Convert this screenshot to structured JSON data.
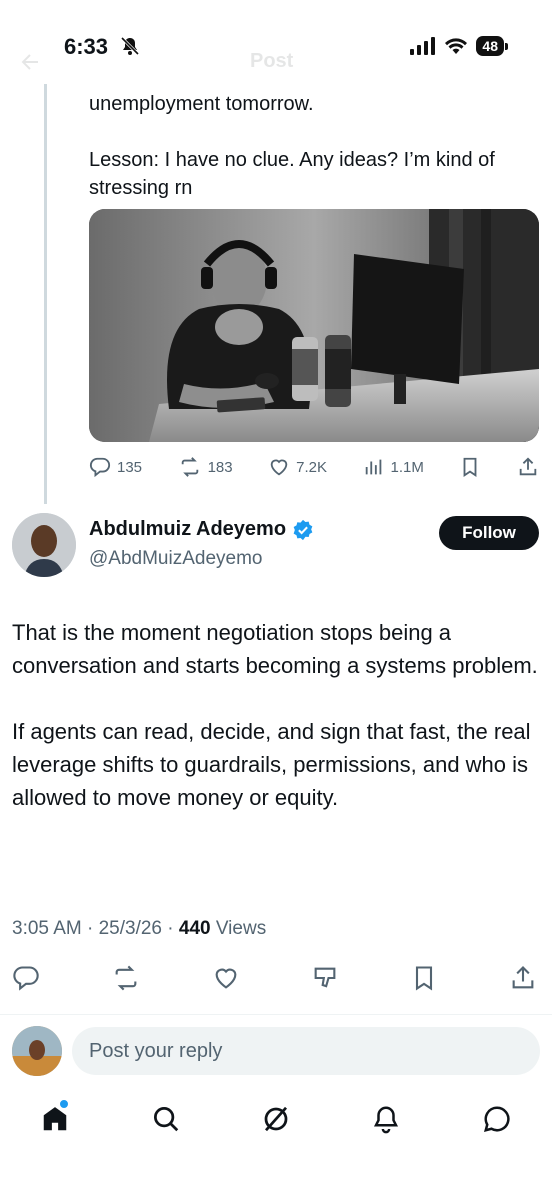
{
  "status_bar": {
    "time": "6:33",
    "battery": "48"
  },
  "faded_header": {
    "title": "Post"
  },
  "parent_tweet": {
    "lines": [
      "unemployment tomorrow.",
      "Lesson: I have no clue. Any ideas? I’m kind of stressing rn"
    ],
    "media_alt": "photo",
    "stats": {
      "replies": "135",
      "reposts": "183",
      "likes": "7.2K",
      "views": "1.1M"
    }
  },
  "tweet": {
    "display_name": "Abdulmuiz Adeyemo",
    "handle": "@AbdMuizAdeyemo",
    "follow_label": "Follow",
    "paragraphs": [
      "That is the moment negotiation stops being a conversation and starts becoming a systems problem.",
      "If agents can read, decide, and sign that fast, the real leverage shifts to guardrails, permissions, and who is allowed to move money or equity."
    ],
    "timestamp": "3:05 AM · 25/3/26 · ",
    "views_count": "440",
    "views_label": " Views"
  },
  "reply": {
    "placeholder": "Post your reply"
  },
  "colors": {
    "accent": "#1d9bf0",
    "text": "#0f1419",
    "muted": "#536471",
    "verified": "#1d9bf0"
  }
}
